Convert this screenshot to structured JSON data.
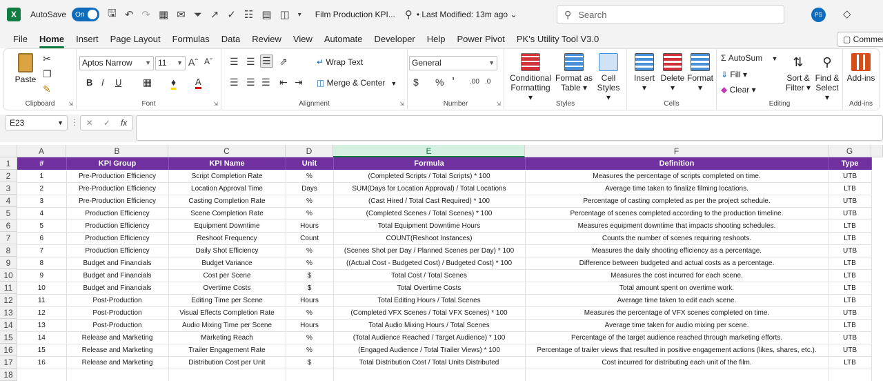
{
  "titlebar": {
    "app_letter": "X",
    "autosave_label": "AutoSave",
    "toggle_label": "On",
    "doc_title": "Film Production KPI...",
    "modified": "• Last Modified: 13m ago ⌄",
    "search_placeholder": "Search",
    "avatar": "PS"
  },
  "menu": {
    "items": [
      "File",
      "Home",
      "Insert",
      "Page Layout",
      "Formulas",
      "Data",
      "Review",
      "View",
      "Automate",
      "Developer",
      "Help",
      "Power Pivot",
      "PK's Utility Tool V3.0"
    ],
    "comments": "Commen"
  },
  "ribbon": {
    "clipboard": {
      "label": "Clipboard",
      "paste": "Paste"
    },
    "font": {
      "label": "Font",
      "name": "Aptos Narrow",
      "size": "11"
    },
    "alignment": {
      "label": "Alignment",
      "wrap": "Wrap Text",
      "merge": "Merge & Center"
    },
    "number": {
      "label": "Number",
      "format": "General"
    },
    "styles": {
      "label": "Styles",
      "cond1": "Conditional",
      "cond2": "Formatting",
      "fmt1": "Format as",
      "fmt2": "Table",
      "cell1": "Cell",
      "cell2": "Styles"
    },
    "cells": {
      "label": "Cells",
      "insert": "Insert",
      "delete": "Delete",
      "format": "Format"
    },
    "editing": {
      "label": "Editing",
      "autosum": "AutoSum",
      "fill": "Fill",
      "clear": "Clear",
      "sort1": "Sort &",
      "sort2": "Filter",
      "find1": "Find &",
      "find2": "Select"
    },
    "addins": {
      "label": "Add-ins",
      "btn": "Add-ins"
    }
  },
  "formula_bar": {
    "cell_ref": "E23",
    "fx": "fx",
    "value": ""
  },
  "columns": [
    "A",
    "B",
    "C",
    "D",
    "E",
    "F",
    "G"
  ],
  "rows": [
    "1",
    "2",
    "3",
    "4",
    "5",
    "6",
    "7",
    "8",
    "9",
    "10",
    "11",
    "12",
    "13",
    "14",
    "15",
    "16",
    "17",
    "18"
  ],
  "table": {
    "headers": [
      "#",
      "KPI Group",
      "KPI Name",
      "Unit",
      "Formula",
      "Definition",
      "Type"
    ],
    "rows": [
      [
        "1",
        "Pre-Production Efficiency",
        "Script Completion Rate",
        "%",
        "(Completed Scripts / Total Scripts) * 100",
        "Measures the percentage of scripts completed on time.",
        "UTB"
      ],
      [
        "2",
        "Pre-Production Efficiency",
        "Location Approval Time",
        "Days",
        "SUM(Days for Location Approval) / Total Locations",
        "Average time taken to finalize filming locations.",
        "LTB"
      ],
      [
        "3",
        "Pre-Production Efficiency",
        "Casting Completion Rate",
        "%",
        "(Cast Hired / Total Cast Required) * 100",
        "Percentage of casting completed as per the project schedule.",
        "UTB"
      ],
      [
        "4",
        "Production Efficiency",
        "Scene Completion Rate",
        "%",
        "(Completed Scenes / Total Scenes) * 100",
        "Percentage of scenes completed according to the production timeline.",
        "UTB"
      ],
      [
        "5",
        "Production Efficiency",
        "Equipment Downtime",
        "Hours",
        "Total Equipment Downtime Hours",
        "Measures equipment downtime that impacts shooting schedules.",
        "LTB"
      ],
      [
        "6",
        "Production Efficiency",
        "Reshoot Frequency",
        "Count",
        "COUNT(Reshoot Instances)",
        "Counts the number of scenes requiring reshoots.",
        "LTB"
      ],
      [
        "7",
        "Production Efficiency",
        "Daily Shot Efficiency",
        "%",
        "(Scenes Shot per Day / Planned Scenes per Day) * 100",
        "Measures the daily shooting efficiency as a percentage.",
        "UTB"
      ],
      [
        "8",
        "Budget and Financials",
        "Budget Variance",
        "%",
        "((Actual Cost - Budgeted Cost) / Budgeted Cost) * 100",
        "Difference between budgeted and actual costs as a percentage.",
        "LTB"
      ],
      [
        "9",
        "Budget and Financials",
        "Cost per Scene",
        "$",
        "Total Cost / Total Scenes",
        "Measures the cost incurred for each scene.",
        "LTB"
      ],
      [
        "10",
        "Budget and Financials",
        "Overtime Costs",
        "$",
        "Total Overtime Costs",
        "Total amount spent on overtime work.",
        "LTB"
      ],
      [
        "11",
        "Post-Production",
        "Editing Time per Scene",
        "Hours",
        "Total Editing Hours / Total Scenes",
        "Average time taken to edit each scene.",
        "LTB"
      ],
      [
        "12",
        "Post-Production",
        "Visual Effects Completion Rate",
        "%",
        "(Completed VFX Scenes / Total VFX Scenes) * 100",
        "Measures the percentage of VFX scenes completed on time.",
        "UTB"
      ],
      [
        "13",
        "Post-Production",
        "Audio Mixing Time per Scene",
        "Hours",
        "Total Audio Mixing Hours / Total Scenes",
        "Average time taken for audio mixing per scene.",
        "LTB"
      ],
      [
        "14",
        "Release and Marketing",
        "Marketing Reach",
        "%",
        "(Total Audience Reached / Target Audience) * 100",
        "Percentage of the target audience reached through marketing efforts.",
        "UTB"
      ],
      [
        "15",
        "Release and Marketing",
        "Trailer Engagement Rate",
        "%",
        "(Engaged Audience / Total Trailer Views) * 100",
        "Percentage of trailer views that resulted in positive engagement actions (likes, shares, etc.).",
        "UTB"
      ],
      [
        "16",
        "Release and Marketing",
        "Distribution Cost per Unit",
        "$",
        "Total Distribution Cost / Total Units Distributed",
        "Cost incurred for distributing each unit of the film.",
        "LTB"
      ]
    ]
  },
  "colors": {
    "header_purple": "#7030a0",
    "excel_green": "#107c41",
    "accent_blue": "#0f6cbd"
  }
}
